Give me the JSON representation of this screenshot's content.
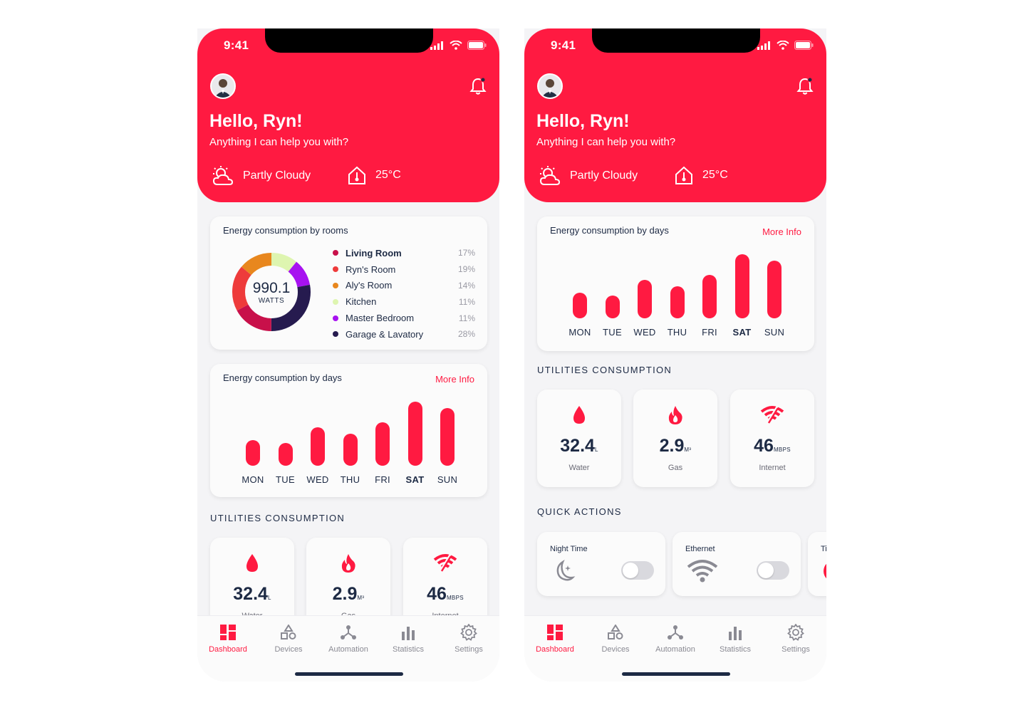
{
  "status": {
    "time": "9:41"
  },
  "greeting": {
    "title": "Hello, Ryn!",
    "subtitle": "Anything I can help you with?"
  },
  "weather": {
    "condition": "Partly Cloudy",
    "temperature": "25°C"
  },
  "rooms": {
    "title": "Energy consumption by rooms",
    "total_value": "990.1",
    "total_unit": "WATTS",
    "items": [
      {
        "name": "Living Room",
        "percent": "17%",
        "color": "#c8104a"
      },
      {
        "name": "Ryn's Room",
        "percent": "19%",
        "color": "#ee3b3b"
      },
      {
        "name": "Aly's Room",
        "percent": "14%",
        "color": "#e8871e"
      },
      {
        "name": "Kitchen",
        "percent": "11%",
        "color": "#def5b0"
      },
      {
        "name": "Master Bedroom",
        "percent": "11%",
        "color": "#a712f0"
      },
      {
        "name": "Garage & Lavatory",
        "percent": "28%",
        "color": "#261b4f"
      }
    ]
  },
  "days": {
    "title": "Energy consumption by days",
    "more": "More Info",
    "labels": [
      "MON",
      "TUE",
      "WED",
      "THU",
      "FRI",
      "SAT",
      "SUN"
    ],
    "active": "SAT"
  },
  "chart_data": {
    "type": "bar",
    "categories": [
      "MON",
      "TUE",
      "WED",
      "THU",
      "FRI",
      "SAT",
      "SUN"
    ],
    "values": [
      36,
      32,
      54,
      45,
      61,
      90,
      81
    ],
    "title": "Energy consumption by days"
  },
  "utilities": {
    "title": "UTILITIES CONSUMPTION",
    "items": [
      {
        "value": "32.4",
        "unit": "L",
        "label": "Water",
        "icon": "water-drop-icon"
      },
      {
        "value": "2.9",
        "unit": "M³",
        "label": "Gas",
        "icon": "flame-icon"
      },
      {
        "value": "46",
        "unit": "MBPS",
        "label": "Internet",
        "icon": "wifi-icon"
      }
    ]
  },
  "quick_actions": {
    "title": "QUICK ACTIONS",
    "items": [
      {
        "label": "Night Time",
        "icon": "moon-icon",
        "on": false
      },
      {
        "label": "Ethernet",
        "icon": "wifi-icon",
        "on": false
      },
      {
        "label": "Ti",
        "icon": "partial-card",
        "on": false
      }
    ]
  },
  "tabs": [
    {
      "label": "Dashboard",
      "icon": "dashboard-icon",
      "active": true
    },
    {
      "label": "Devices",
      "icon": "devices-icon",
      "active": false
    },
    {
      "label": "Automation",
      "icon": "automation-icon",
      "active": false
    },
    {
      "label": "Statistics",
      "icon": "statistics-icon",
      "active": false
    },
    {
      "label": "Settings",
      "icon": "settings-icon",
      "active": false
    }
  ],
  "colors": {
    "accent": "#ff1a41",
    "text": "#1d2a44",
    "background": "#f4f4f6"
  }
}
